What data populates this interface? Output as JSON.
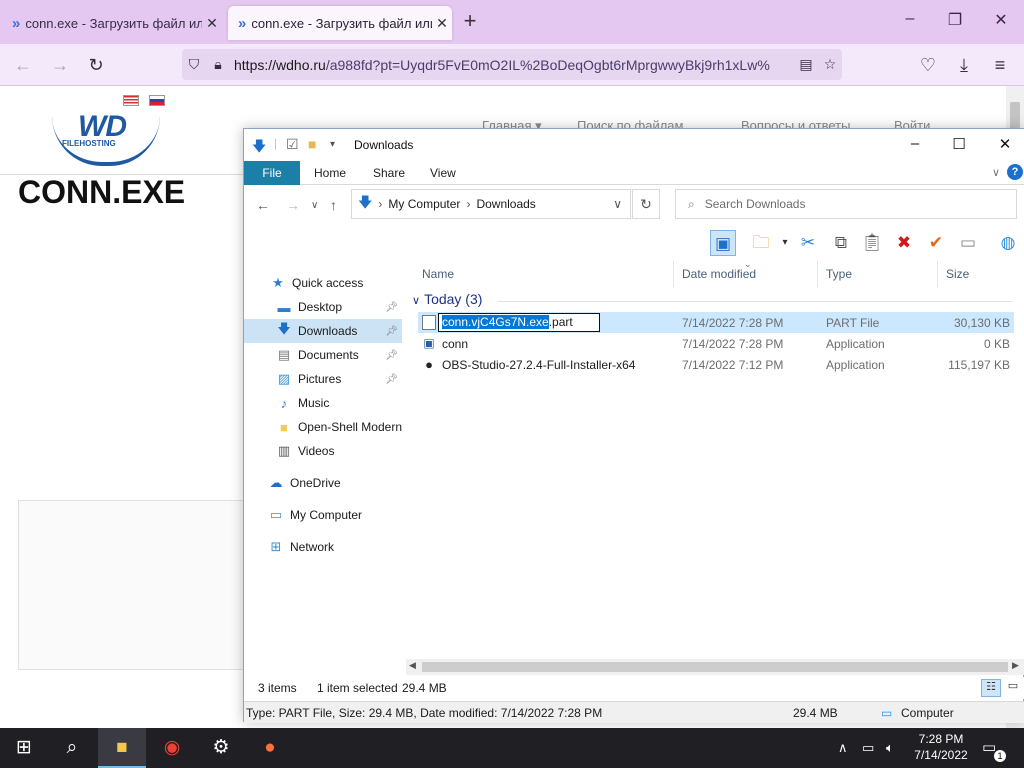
{
  "browser": {
    "tabs": [
      {
        "title": "conn.exe - Загрузить файл или"
      },
      {
        "title": "conn.exe - Загрузить файл или"
      }
    ],
    "url": "https://wdho.ru/a988fd?pt=Uyqdr5FvE0mO2IL%2BoDeqOgbt6rMprgwwyBkj9rh1xLw%",
    "url_host": "https://wdho.ru",
    "url_rest": "/a988fd?pt=Uyqdr5FvE0mO2IL%2BoDeqOgbt6rMprgwwyBkj9rh1xLw%"
  },
  "site": {
    "logo_text": "WD",
    "logo_sub": "FILEHOSTING",
    "nav": [
      "Главная ▾",
      "Поиск по файлам",
      "Вопросы и ответы",
      "Войти"
    ],
    "title": "CONN.EXE"
  },
  "explorer": {
    "title": "Downloads",
    "ribbon_tabs": [
      "File",
      "Home",
      "Share",
      "View"
    ],
    "address": [
      "My Computer",
      "Downloads"
    ],
    "search_placeholder": "Search Downloads",
    "nav_pane": [
      {
        "label": "Quick access",
        "icon": "star-icon"
      },
      {
        "label": "Desktop",
        "icon": "desktop-icon",
        "pinned": true
      },
      {
        "label": "Downloads",
        "icon": "download-arrow-icon",
        "pinned": true,
        "selected": true
      },
      {
        "label": "Documents",
        "icon": "document-icon",
        "pinned": true
      },
      {
        "label": "Pictures",
        "icon": "picture-icon",
        "pinned": true
      },
      {
        "label": "Music",
        "icon": "music-note-icon"
      },
      {
        "label": "Open-Shell Modern",
        "icon": "folder-icon"
      },
      {
        "label": "Videos",
        "icon": "video-icon"
      },
      {
        "label": "OneDrive",
        "icon": "cloud-icon"
      },
      {
        "label": "My Computer",
        "icon": "computer-icon"
      },
      {
        "label": "Network",
        "icon": "network-icon"
      }
    ],
    "columns": [
      "Name",
      "Date modified",
      "Type",
      "Size"
    ],
    "group_label": "Today (3)",
    "files": [
      {
        "name": "conn.vjC4Gs7N.exe.part",
        "name_selected": "conn.vjC4Gs7N.exe",
        "name_tail": ".part",
        "date": "7/14/2022 7:28 PM",
        "type": "PART File",
        "size": "30,130 KB"
      },
      {
        "name": "conn",
        "date": "7/14/2022 7:28 PM",
        "type": "Application",
        "size": "0 KB"
      },
      {
        "name": "OBS-Studio-27.2.4-Full-Installer-x64",
        "date": "7/14/2022 7:12 PM",
        "type": "Application",
        "size": "115,197 KB"
      }
    ],
    "status": {
      "items": "3 items",
      "selected": "1 item selected",
      "selected_size": "29.4 MB",
      "details": "Type: PART File, Size: 29.4 MB, Date modified: 7/14/2022 7:28 PM",
      "size": "29.4 MB",
      "location": "Computer"
    }
  },
  "taskbar": {
    "time": "7:28 PM",
    "date": "7/14/2022",
    "notification_count": "1"
  },
  "colors": {
    "tabbar": "#e4c8f2",
    "navbar": "#f4e9fa",
    "file_tab": "#1b7fa8",
    "selection": "#cce8ff",
    "rename_highlight": "#0078d7",
    "taskbar": "#1f1f24"
  }
}
